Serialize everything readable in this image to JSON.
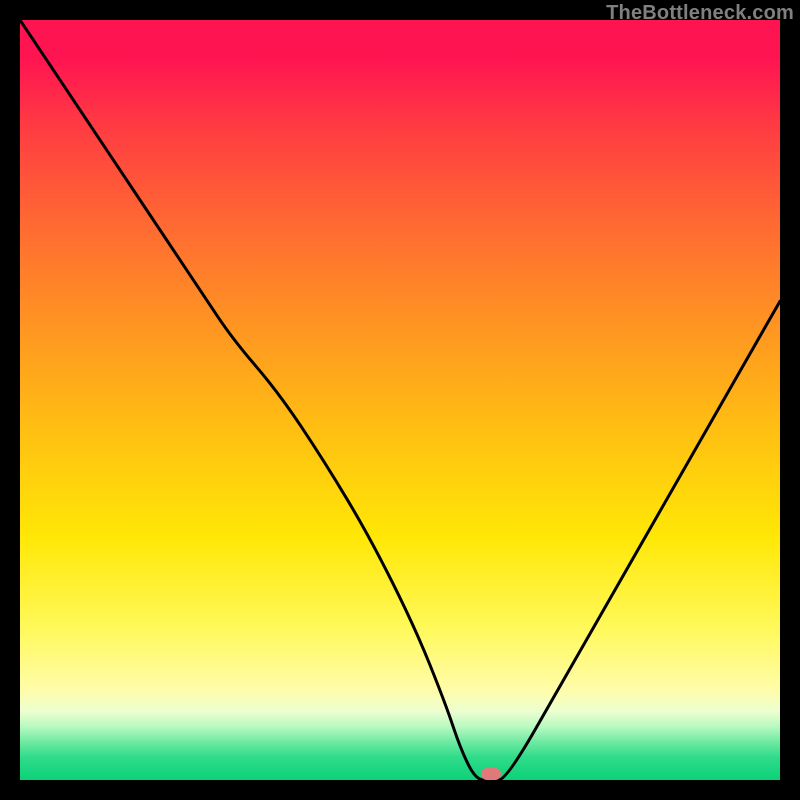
{
  "watermark": "TheBottleneck.com",
  "marker": {
    "x_pct": 62,
    "y_pct": 99.2
  },
  "chart_data": {
    "type": "line",
    "title": "",
    "xlabel": "",
    "ylabel": "",
    "xlim": [
      0,
      100
    ],
    "ylim": [
      0,
      100
    ],
    "grid": false,
    "legend": false,
    "series": [
      {
        "name": "bottleneck-curve",
        "color": "#000000",
        "x": [
          0,
          8,
          16,
          24,
          28,
          34,
          40,
          46,
          52,
          56,
          58,
          60,
          62,
          64,
          72,
          80,
          88,
          96,
          100
        ],
        "y": [
          100,
          88,
          76,
          64,
          58,
          51,
          42,
          32,
          20,
          10,
          4,
          0,
          0,
          0,
          14,
          28,
          42,
          56,
          63
        ]
      }
    ],
    "annotations": [
      {
        "type": "marker",
        "x": 62,
        "y": 0,
        "label": "optimal-point"
      }
    ],
    "background_gradient": {
      "direction": "vertical",
      "stops": [
        {
          "pct": 0,
          "color": "#ff1452"
        },
        {
          "pct": 5,
          "color": "#ff1452"
        },
        {
          "pct": 14,
          "color": "#ff3b42"
        },
        {
          "pct": 27,
          "color": "#ff6a32"
        },
        {
          "pct": 40,
          "color": "#ff9422"
        },
        {
          "pct": 54,
          "color": "#ffbf12"
        },
        {
          "pct": 68,
          "color": "#ffe706"
        },
        {
          "pct": 80,
          "color": "#fff95a"
        },
        {
          "pct": 88,
          "color": "#fffca8"
        },
        {
          "pct": 91,
          "color": "#ecffd0"
        },
        {
          "pct": 93,
          "color": "#b8f9c1"
        },
        {
          "pct": 95,
          "color": "#6fe9a2"
        },
        {
          "pct": 97,
          "color": "#2fdc8a"
        },
        {
          "pct": 100,
          "color": "#0cd178"
        }
      ]
    }
  }
}
